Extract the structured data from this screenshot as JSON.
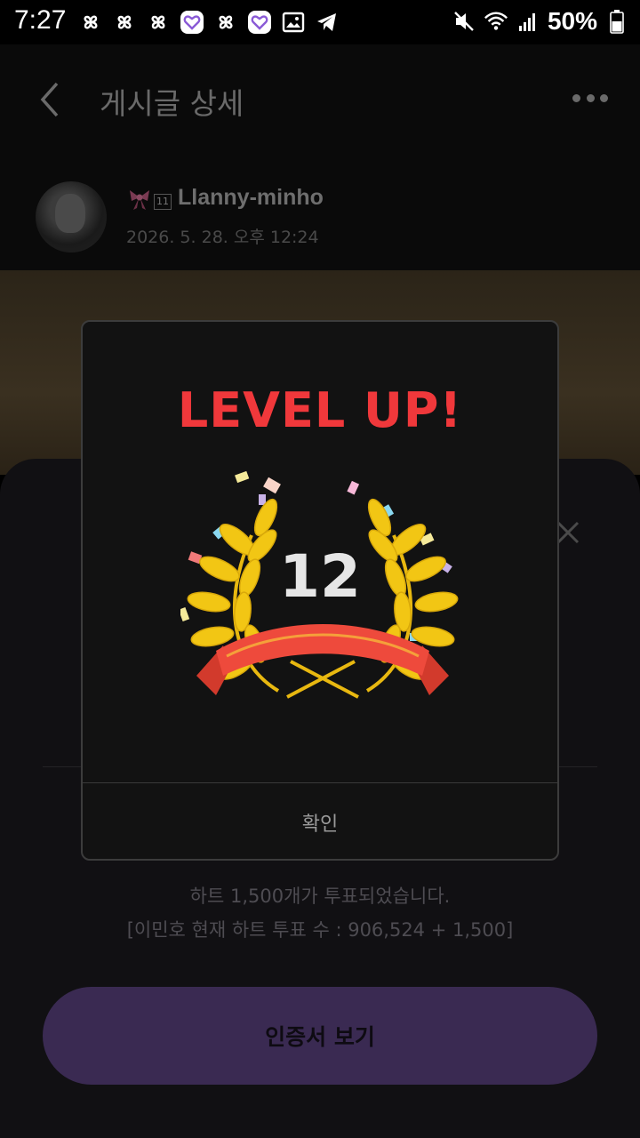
{
  "status_bar": {
    "time": "7:27",
    "battery": "50%",
    "left_icons": [
      "pinwheel-icon",
      "pinwheel-icon",
      "pinwheel-icon",
      "heart-app-icon",
      "pinwheel-icon",
      "heart-app-icon",
      "gallery-icon",
      "telegram-icon"
    ],
    "right_icons": [
      "mute-icon",
      "wifi-icon",
      "signal-icon",
      "battery-icon"
    ]
  },
  "header": {
    "title": "게시글 상세"
  },
  "author": {
    "name": "Llanny-minho",
    "level_chip": "11",
    "date": "2026. 5. 28. 오후 12:24"
  },
  "sheet": {
    "message_line1": "하트 1,500개가 투표되었습니다.",
    "message_line2": "[이민호 현재 하트 투표 수 : 906,524 + 1,500]",
    "certificate_button": "인증서 보기"
  },
  "dialog": {
    "title": "LEVEL UP!",
    "level": "12",
    "confirm_label": "확인"
  },
  "colors": {
    "title_red": "#f0383b",
    "button_purple": "#3a2a52",
    "wreath_gold": "#f2c614",
    "ribbon_red": "#ee4a3c"
  }
}
